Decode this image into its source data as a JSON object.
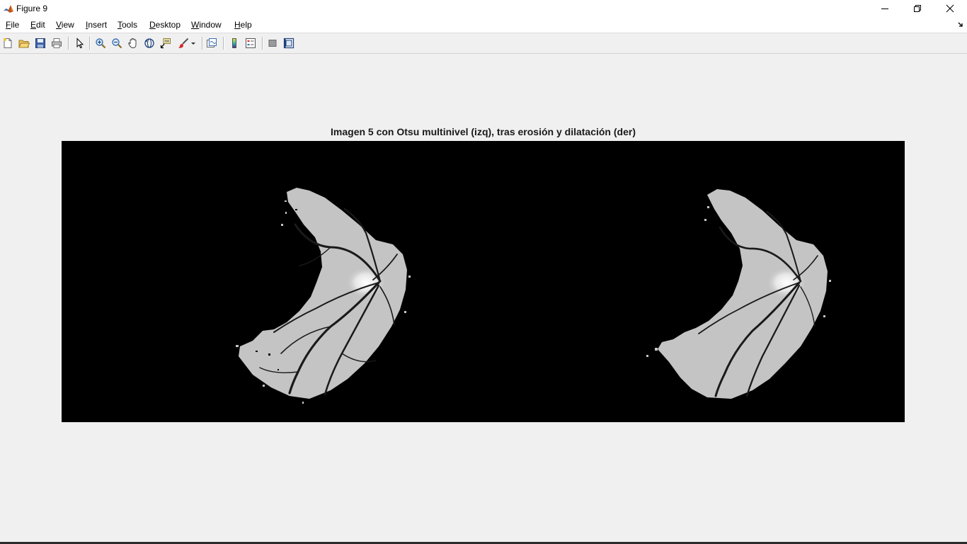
{
  "window": {
    "title": "Figure 9",
    "controls": [
      "minimize",
      "restore",
      "close"
    ]
  },
  "menu": {
    "items": [
      {
        "mnemonic": "F",
        "rest": "ile"
      },
      {
        "mnemonic": "E",
        "rest": "dit"
      },
      {
        "mnemonic": "V",
        "rest": "iew"
      },
      {
        "mnemonic": "I",
        "rest": "nsert"
      },
      {
        "mnemonic": "T",
        "rest": "ools"
      },
      {
        "mnemonic": "D",
        "rest": "esktop"
      },
      {
        "mnemonic": "W",
        "rest": "indow"
      },
      {
        "mnemonic": "H",
        "rest": "elp"
      }
    ]
  },
  "toolbar": {
    "icons": [
      "new-figure-icon",
      "open-file-icon",
      "save-figure-icon",
      "print-figure-icon",
      "edit-plot-icon",
      "zoom-in-icon",
      "zoom-out-icon",
      "pan-icon",
      "rotate-3d-icon",
      "data-cursor-icon",
      "brush-icon",
      "link-plot-icon",
      "insert-colorbar-icon",
      "insert-legend-icon",
      "hide-plot-tools-icon",
      "show-plot-tools-icon"
    ]
  },
  "figure": {
    "axes_title": "Imagen 5 con Otsu multinivel (izq), tras erosión y dilatación (der)",
    "background": "#000000",
    "images": [
      {
        "name": "otsu-multilevel-segmented-retina",
        "side": "left"
      },
      {
        "name": "eroded-dilated-retina",
        "side": "right"
      }
    ]
  },
  "colors": {
    "titlebar": "#ffffff",
    "menubar": "#ffffff",
    "toolbar": "#f0f0f0",
    "figure_bg": "#f0f0f0",
    "axes_bg": "#000000",
    "retina_gray": "#c8c8c8"
  }
}
